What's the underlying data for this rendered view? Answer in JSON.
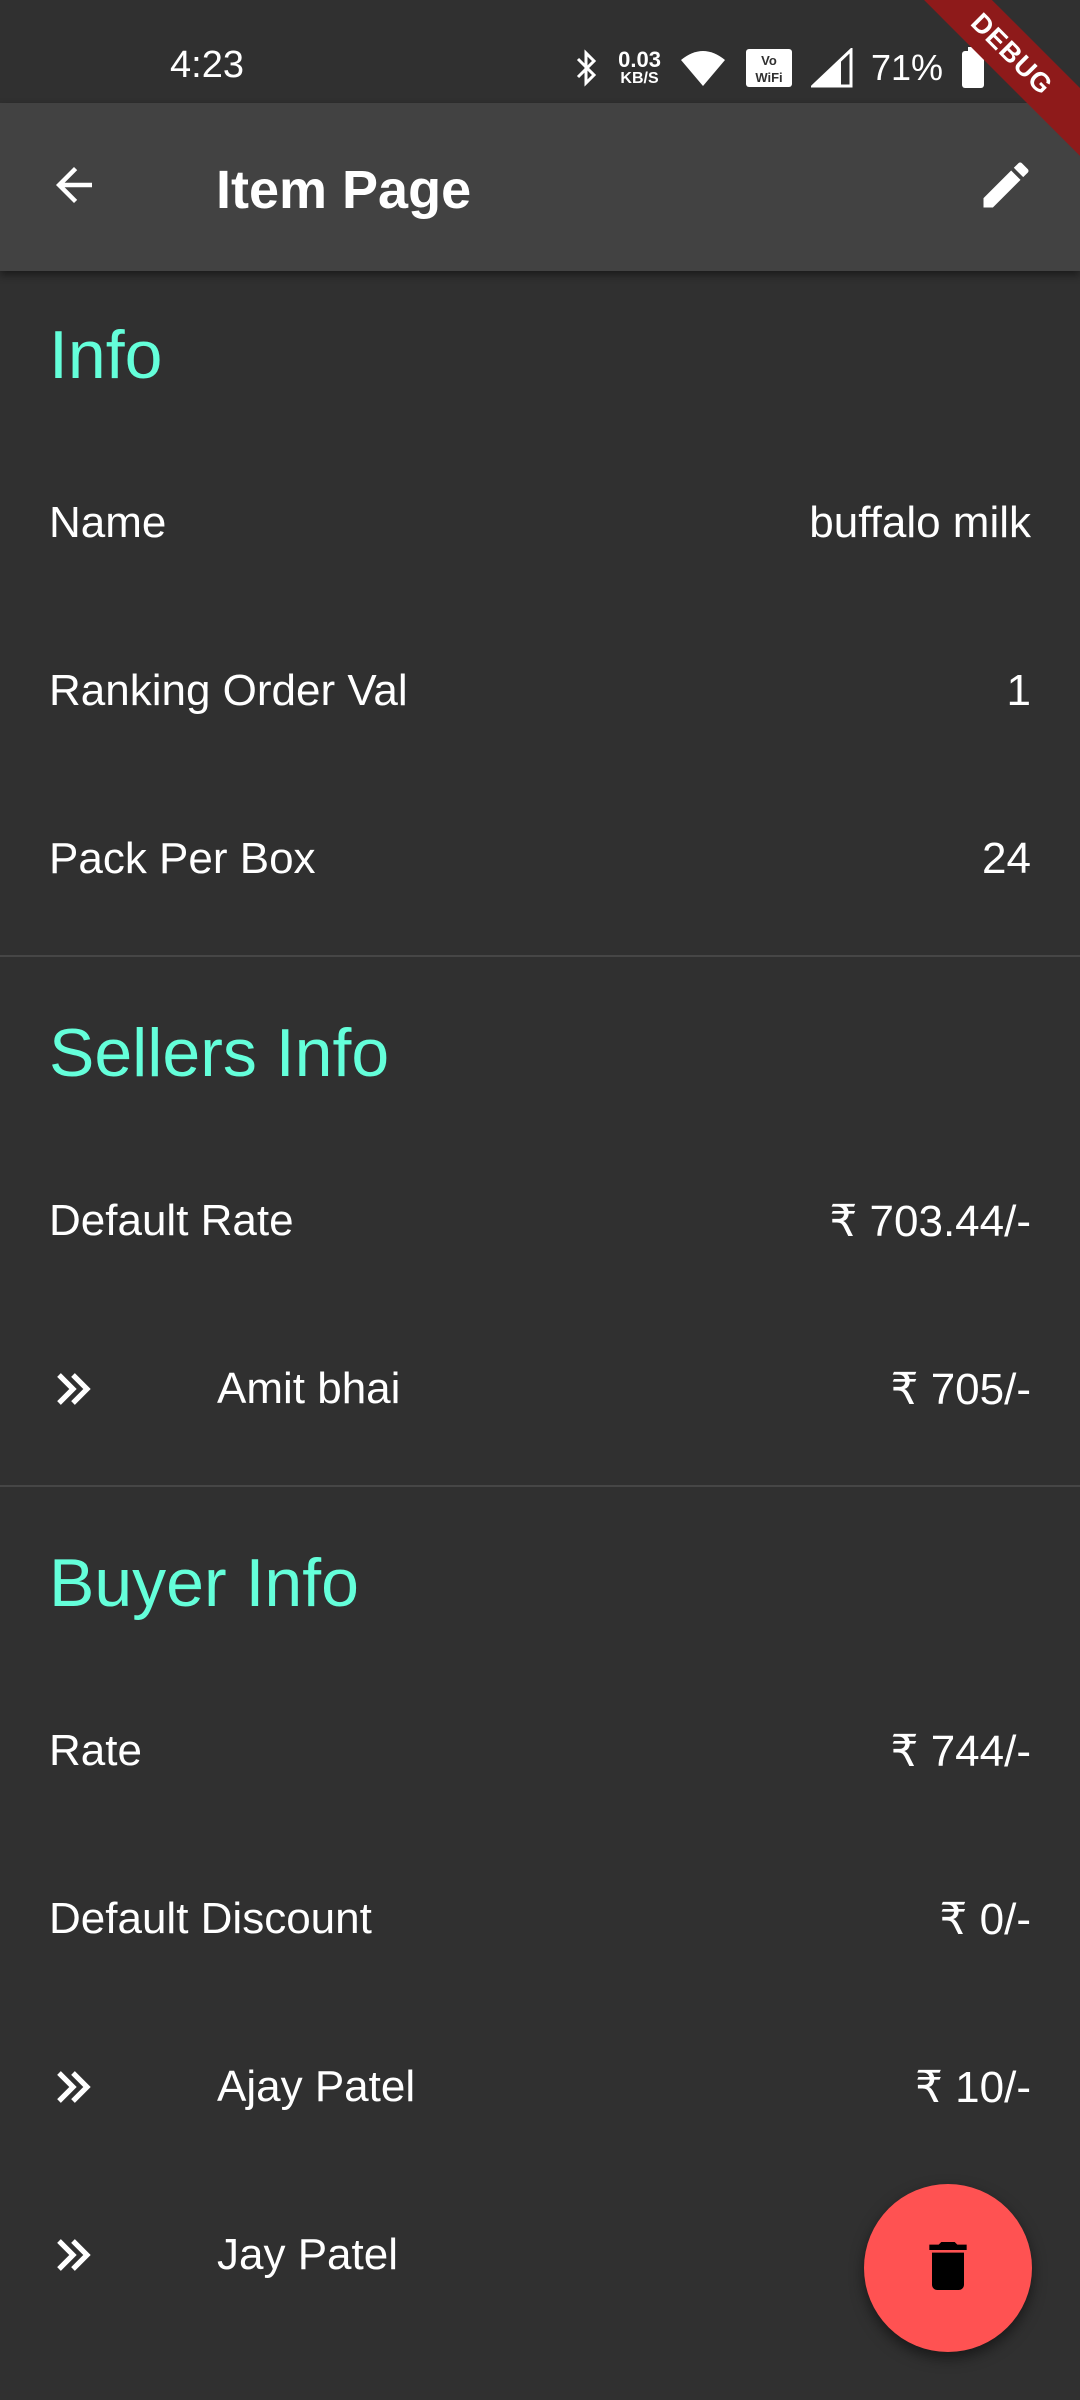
{
  "status_bar": {
    "time": "4:23",
    "net_speed_value": "0.03",
    "net_speed_unit": "KB/S",
    "volte_label": "Vo WiFi",
    "battery": "71%",
    "icons": [
      "bluetooth-icon",
      "wifi-icon",
      "vowifi-icon",
      "signal-icon",
      "battery-icon"
    ]
  },
  "debug_banner": "DEBUG",
  "app_bar": {
    "title": "Item Page",
    "back_icon": "arrow-back-icon",
    "edit_icon": "edit-icon"
  },
  "sections": {
    "info": {
      "title": "Info",
      "rows": [
        {
          "label": "Name",
          "value": "buffalo milk"
        },
        {
          "label": "Ranking Order Val",
          "value": "1"
        },
        {
          "label": "Pack Per Box",
          "value": "24"
        }
      ]
    },
    "sellers": {
      "title": "Sellers Info",
      "default_rate_label": "Default Rate",
      "default_rate_value": "₹ 703.44/-",
      "entries": [
        {
          "name": "Amit bhai",
          "value": "₹ 705/-"
        }
      ]
    },
    "buyer": {
      "title": "Buyer Info",
      "rate_label": "Rate",
      "rate_value": "₹ 744/-",
      "discount_label": "Default Discount",
      "discount_value": "₹ 0/-",
      "entries": [
        {
          "name": "Ajay Patel",
          "value": "₹ 10/-"
        },
        {
          "name": "Jay Patel",
          "value": ""
        }
      ]
    }
  },
  "fab": {
    "icon": "delete-icon"
  },
  "colors": {
    "background": "#303030",
    "app_bar": "#424242",
    "accent": "#64ffda",
    "fab": "#ff5252",
    "debug_banner": "#8e1a1a"
  }
}
